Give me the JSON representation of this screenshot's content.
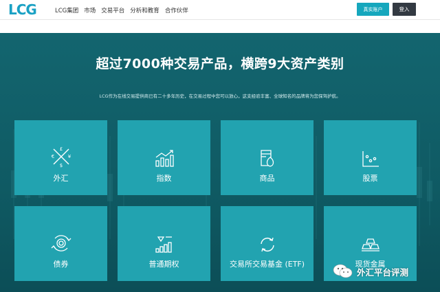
{
  "header": {
    "logo": "LCG",
    "nav": [
      "LCG集团",
      "市场",
      "交易平台",
      "分析和教育",
      "合作伙伴"
    ],
    "open_account_label": "真实账户",
    "login_label": "登入"
  },
  "hero": {
    "headline": "超过7000种交易产品，横跨9大资产类别",
    "subline": "LCG作为在线交易提供商已有二十多年历史，在交易过程中您可以放心，这支经验丰富、全球知名的品牌将为您保驾护航。"
  },
  "cards": [
    {
      "label": "外汇",
      "icon": "currency-exchange-icon"
    },
    {
      "label": "指数",
      "icon": "bar-chart-icon"
    },
    {
      "label": "商品",
      "icon": "commodity-beaker-icon"
    },
    {
      "label": "股票",
      "icon": "scatter-chart-icon"
    },
    {
      "label": "债券",
      "icon": "bond-cycle-icon"
    },
    {
      "label": "普通期权",
      "icon": "options-chart-icon"
    },
    {
      "label": "交易所交易基金 (ETF)",
      "icon": "refresh-arrows-icon"
    },
    {
      "label": "现货金属",
      "icon": "metal-bars-icon"
    }
  ],
  "watermark": {
    "text": "外汇平台评测",
    "icon": "wechat-icon"
  },
  "colors": {
    "brand": "#1aa1c4",
    "open_button": "#16a7bd",
    "login_button": "#333a42",
    "hero_bg": "#13656f",
    "card_bg": "#22a3b0"
  }
}
